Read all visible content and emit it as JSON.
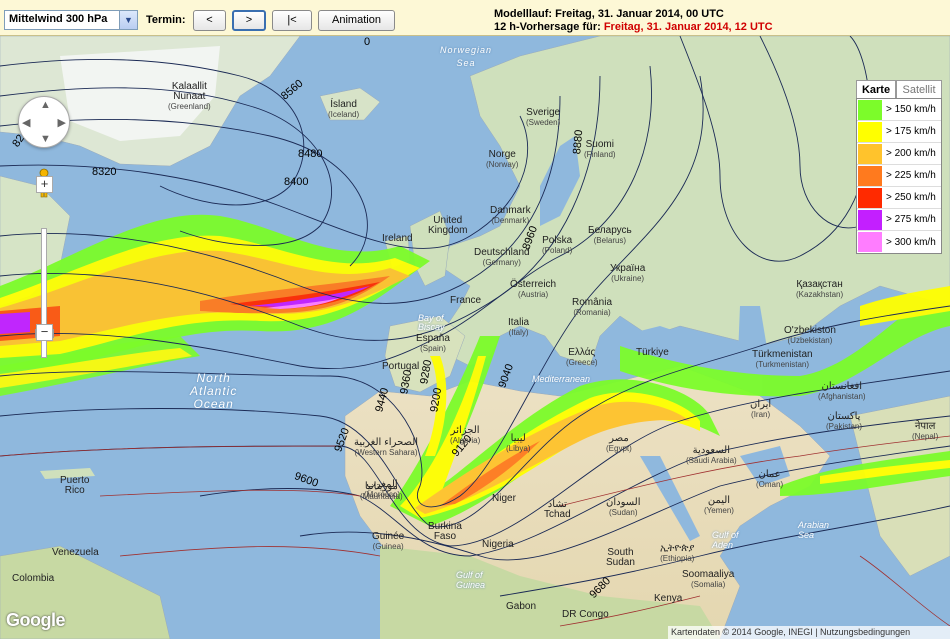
{
  "toolbar": {
    "product_select": "Mittelwind 300 hPa",
    "termin_label": "Termin:",
    "btn_prev": "<",
    "btn_next": ">",
    "btn_first": "|<",
    "btn_animation": "Animation",
    "run_label": "Modelllauf: Freitag, 31. Januar 2014, 00 UTC",
    "forecast_prefix": "12 h-Vorhersage für: ",
    "forecast_value": "Freitag, 31. Januar 2014, 12 UTC"
  },
  "map_types": {
    "map": "Karte",
    "satellite": "Satellit"
  },
  "legend": [
    {
      "label": "> 150 km/h",
      "color": "#7cfc2a"
    },
    {
      "label": "> 175 km/h",
      "color": "#ffff00"
    },
    {
      "label": "> 200 km/h",
      "color": "#ffc32c"
    },
    {
      "label": "> 225 km/h",
      "color": "#ff7a1e"
    },
    {
      "label": "> 250 km/h",
      "color": "#ff2a00"
    },
    {
      "label": "> 275 km/h",
      "color": "#c31fff"
    },
    {
      "label": "> 300 km/h",
      "color": "#ff7dff"
    }
  ],
  "contours": [
    "8240",
    "8320",
    "8400",
    "8480",
    "8560",
    "9120",
    "9200",
    "9280",
    "9360",
    "9440",
    "9520",
    "9600",
    "9680",
    "9040",
    "8960",
    "8880",
    "0"
  ],
  "places": [
    {
      "name": "Kalaallit",
      "sub": "Nunaat",
      "sub2": "(Greenland)"
    },
    {
      "name": "Ísland",
      "sub": "(Iceland)"
    },
    {
      "name": "Norwegian",
      "sub": "Sea"
    },
    {
      "name": "Norge",
      "sub": "(Norway)"
    },
    {
      "name": "Sverige",
      "sub": "(Sweden)"
    },
    {
      "name": "Suomi",
      "sub": "(Finland)"
    },
    {
      "name": "Danmark",
      "sub": "(Denmark)"
    },
    {
      "name": "United",
      "sub": "Kingdom"
    },
    {
      "name": "Ireland",
      "sub": ""
    },
    {
      "name": "Deutschland",
      "sub": "(Germany)"
    },
    {
      "name": "Polska",
      "sub": "(Poland)"
    },
    {
      "name": "Беларусь",
      "sub": "(Belarus)"
    },
    {
      "name": "Україна",
      "sub": "(Ukraine)"
    },
    {
      "name": "France",
      "sub": ""
    },
    {
      "name": "Österreich",
      "sub": "(Austria)"
    },
    {
      "name": "România",
      "sub": "(Romania)"
    },
    {
      "name": "Italia",
      "sub": "(Italy)"
    },
    {
      "name": "España",
      "sub": "(Spain)"
    },
    {
      "name": "Portugal",
      "sub": ""
    },
    {
      "name": "Ελλάς",
      "sub": "(Greece)"
    },
    {
      "name": "Türkiye",
      "sub": ""
    },
    {
      "name": "Қазақстан",
      "sub": "(Kazakhstan)"
    },
    {
      "name": "O'zbekiston",
      "sub": "(Uzbekistan)"
    },
    {
      "name": "Türkmenistan",
      "sub": "(Turkmenistan)"
    },
    {
      "name": "افغانستان",
      "sub": "(Afghanistan)"
    },
    {
      "name": "ایران",
      "sub": "(Iran)"
    },
    {
      "name": "پاکستان",
      "sub": "(Pakistan)"
    },
    {
      "name": "नेपाल",
      "sub": "(Nepal)"
    },
    {
      "name": "المغرب",
      "sub": "(Morocco)"
    },
    {
      "name": "الجزائر",
      "sub": "(Algeria)"
    },
    {
      "name": "ليبيا",
      "sub": "(Libya)"
    },
    {
      "name": "مصر",
      "sub": "(Egypt)"
    },
    {
      "name": "السعودية",
      "sub": "(Saudi Arabia)"
    },
    {
      "name": "الصحراء الغربية",
      "sub": "(Western Sahara)"
    },
    {
      "name": "موريتانيا",
      "sub": "(Mauritania)"
    },
    {
      "name": "Niger",
      "sub": ""
    },
    {
      "name": "تشاد",
      "sub": "Tchad"
    },
    {
      "name": "السودان",
      "sub": "(Sudan)"
    },
    {
      "name": "اليمن",
      "sub": "(Yemen)"
    },
    {
      "name": "عمان",
      "sub": "(Oman)"
    },
    {
      "name": "Burkina",
      "sub": "Faso"
    },
    {
      "name": "Guinée",
      "sub": "(Guinea)"
    },
    {
      "name": "Nigeria",
      "sub": ""
    },
    {
      "name": "South",
      "sub": "Sudan"
    },
    {
      "name": "ኢትዮጵያ",
      "sub": "(Ethiopia)"
    },
    {
      "name": "Soomaaliya",
      "sub": "(Somalia)"
    },
    {
      "name": "Kenya",
      "sub": ""
    },
    {
      "name": "DR Congo",
      "sub": ""
    },
    {
      "name": "Gabon",
      "sub": ""
    },
    {
      "name": "Venezuela",
      "sub": ""
    },
    {
      "name": "Colombia",
      "sub": ""
    },
    {
      "name": "Puerto",
      "sub": "Rico"
    }
  ],
  "oceans": {
    "north_atlantic": "North\nAtlantic\nOcean",
    "mediterranean": "Mediterranean",
    "bay_of_biscay": "Bay of\nBiscay",
    "arabian_sea": "Arabian\nSea",
    "gulf_of_guinea": "Gulf of\nGuinea",
    "gulf_of_aden": "Gulf of\nAden"
  },
  "google_logo": "Google",
  "attribution": "Kartendaten © 2014 Google, INEGI  |  Nutzungsbedingungen"
}
